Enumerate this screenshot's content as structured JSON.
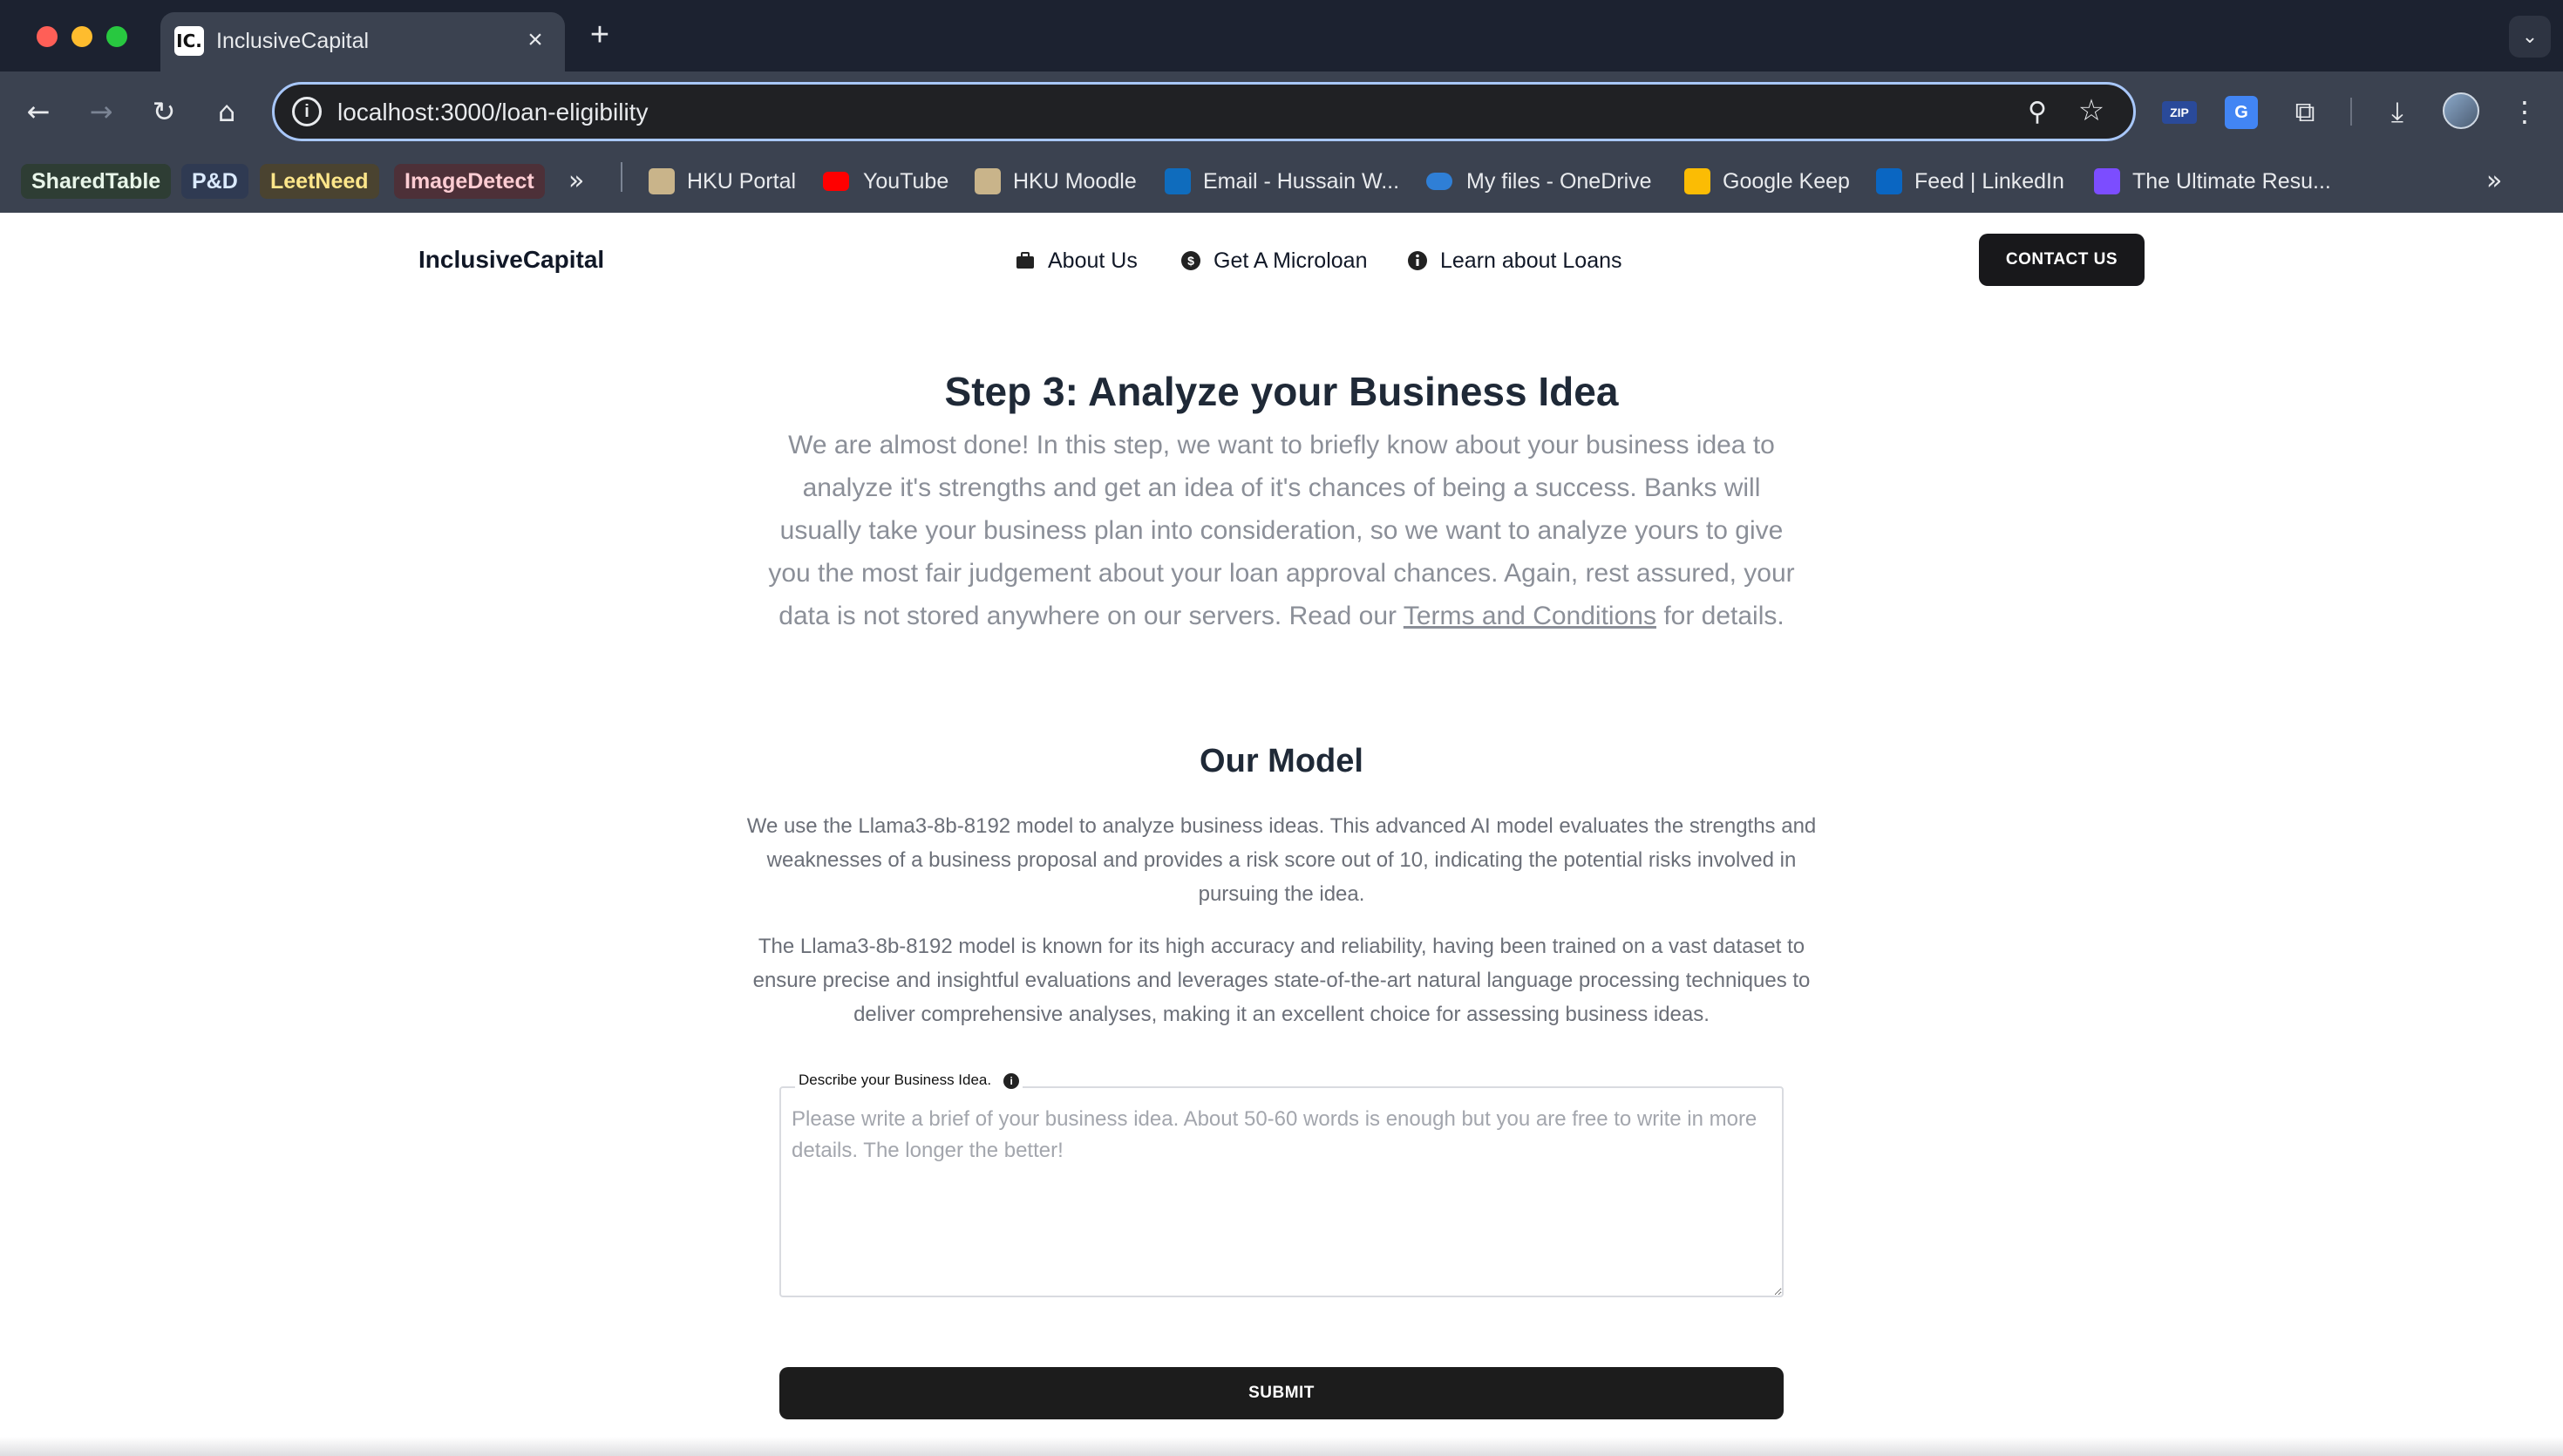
{
  "browser": {
    "tab_title": "InclusiveCapital",
    "tab_favicon_text": "IC.",
    "url": "localhost:3000/loan-eligibility",
    "extensions": {
      "zip_label": "ZIP",
      "translate_label": "G"
    },
    "bookmarks_pills": [
      {
        "label": "SharedTable",
        "color": "#e8f5e9",
        "bg": "#2e3d34"
      },
      {
        "label": "P&D",
        "color": "#dbeafe",
        "bg": "#2f3a52"
      },
      {
        "label": "LeetNeed",
        "color": "#fde68a",
        "bg": "#4a4330"
      },
      {
        "label": "ImageDetect",
        "color": "#fecdd3",
        "bg": "#4d3038"
      }
    ],
    "bookmarks": [
      {
        "label": "HKU Portal",
        "icon": "hku-icon"
      },
      {
        "label": "YouTube",
        "icon": "youtube-icon"
      },
      {
        "label": "HKU Moodle",
        "icon": "hku-icon"
      },
      {
        "label": "Email - Hussain W...",
        "icon": "outlook-icon"
      },
      {
        "label": "My files - OneDrive",
        "icon": "onedrive-icon"
      },
      {
        "label": "Google Keep",
        "icon": "keep-icon"
      },
      {
        "label": "Feed | LinkedIn",
        "icon": "linkedin-icon"
      },
      {
        "label": "The Ultimate Resu...",
        "icon": "resume-icon"
      }
    ]
  },
  "site": {
    "brand": "InclusiveCapital",
    "nav": [
      {
        "label": "About Us",
        "icon": "briefcase-icon"
      },
      {
        "label": "Get A Microloan",
        "icon": "dollar-icon"
      },
      {
        "label": "Learn about Loans",
        "icon": "info-icon"
      }
    ],
    "contact_label": "CONTACT US"
  },
  "main": {
    "step_title": "Step 3: Analyze your Business Idea",
    "intro_text": "We are almost done! In this step, we want to briefly know about your business idea to analyze it's strengths and get an idea of it's chances of being a success. Banks will usually take your business plan into consideration, so we want to analyze yours to give you the most fair judgement about your loan approval chances. Again, rest assured, your data is not stored anywhere on our servers. Read our",
    "terms_link": "Terms and Conditions",
    "intro_suffix": "for details.",
    "model_title": "Our Model",
    "model_paragraph_1": "We use the Llama3-8b-8192 model to analyze business ideas. This advanced AI model evaluates the strengths and weaknesses of a business proposal and provides a risk score out of 10, indicating the potential risks involved in pursuing the idea.",
    "model_paragraph_2": "The Llama3-8b-8192 model is known for its high accuracy and reliability, having been trained on a vast dataset to ensure precise and insightful evaluations and leverages state-of-the-art natural language processing techniques to deliver comprehensive analyses, making it an excellent choice for assessing business ideas.",
    "field_label": "Describe your Business Idea.",
    "field_value": "",
    "field_placeholder": "Please write a brief of your business idea. About 50-60 words is enough but you are free to write in more details. The longer the better!",
    "submit_label": "SUBMIT"
  }
}
